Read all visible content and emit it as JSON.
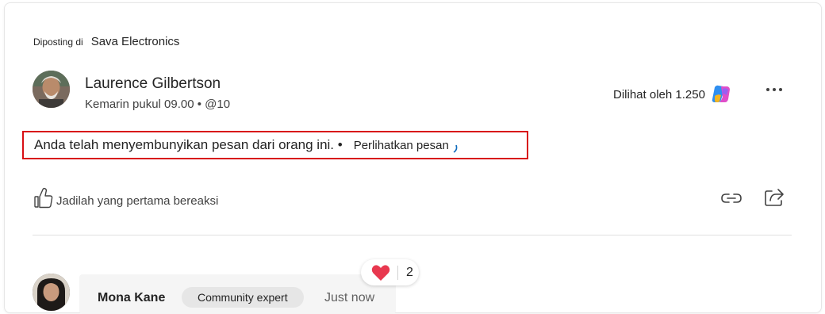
{
  "post": {
    "posted_in_prefix": "Diposting di",
    "community": "Sava Electronics",
    "author_name": "Laurence Gilbertson",
    "author_meta": "Kemarin pukul 09.00 • @10",
    "views_text": "Dilihat oleh 1.250",
    "hidden_notice": "Anda telah menyembunyikan pesan dari orang ini. •",
    "show_message_label": "Perlihatkan pesan",
    "first_react_label": "Jadilah yang pertama bereaksi"
  },
  "comment": {
    "author_name": "Mona Kane",
    "badge": "Community expert",
    "time": "Just now",
    "reaction_count": "2"
  },
  "icons": {
    "copilot": "copilot-icon",
    "more": "more-horizontal-icon",
    "like": "thumb-like-icon",
    "link": "link-icon",
    "share": "share-icon",
    "heart": "heart-icon"
  },
  "colors": {
    "highlight_border": "#d80f14",
    "heart": "#e8384f",
    "link_accent": "#0f6cbd"
  }
}
